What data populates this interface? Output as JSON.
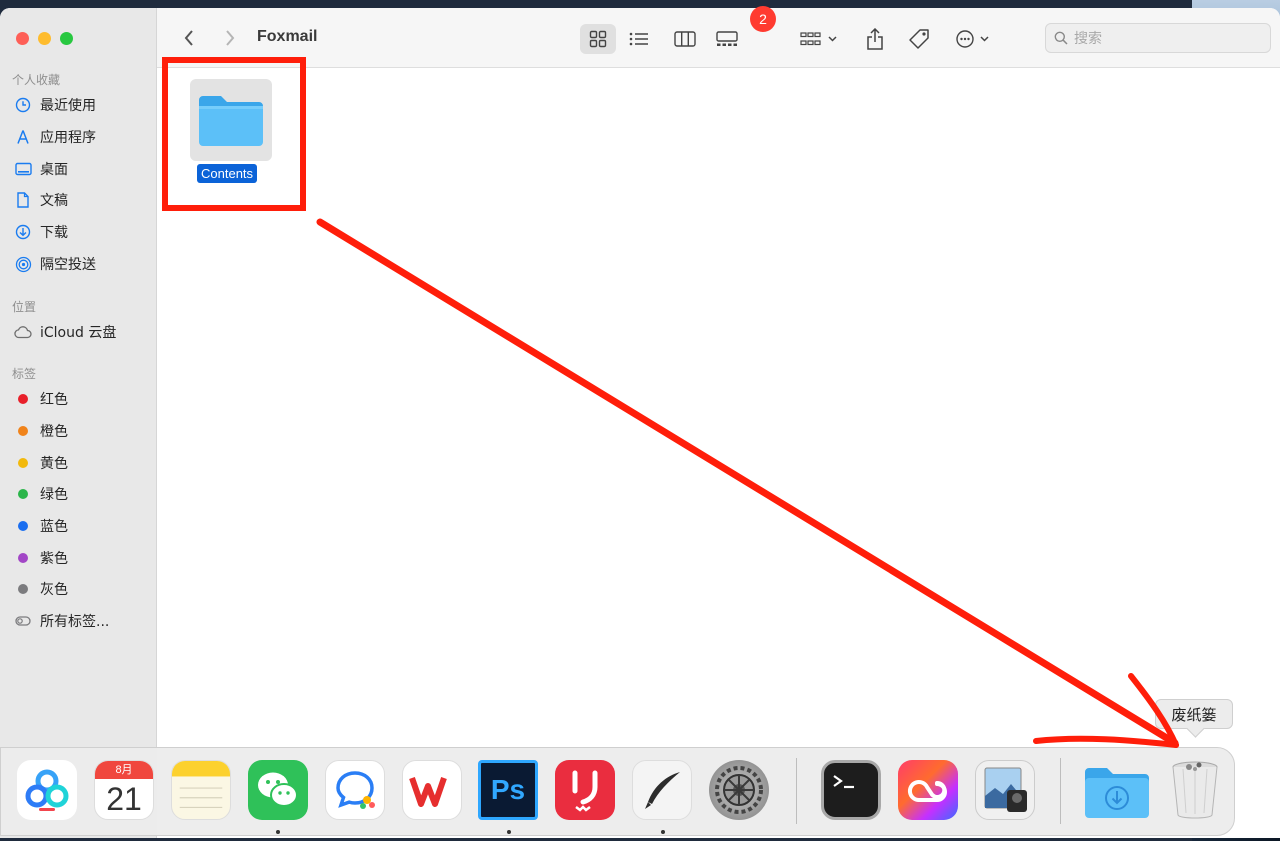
{
  "window": {
    "title": "Foxmail",
    "search_placeholder": "搜索"
  },
  "sidebar": {
    "favorites_header": "个人收藏",
    "favorites": [
      {
        "label": "最近使用",
        "icon": "clock-icon"
      },
      {
        "label": "应用程序",
        "icon": "apps-icon"
      },
      {
        "label": "桌面",
        "icon": "desktop-icon"
      },
      {
        "label": "文稿",
        "icon": "document-icon"
      },
      {
        "label": "下载",
        "icon": "download-icon"
      },
      {
        "label": "隔空投送",
        "icon": "airdrop-icon"
      }
    ],
    "locations_header": "位置",
    "locations": [
      {
        "label": "iCloud 云盘",
        "icon": "cloud-icon"
      }
    ],
    "tags_header": "标签",
    "tags": [
      {
        "label": "红色",
        "color": "#e8202a"
      },
      {
        "label": "橙色",
        "color": "#f0831a"
      },
      {
        "label": "黄色",
        "color": "#f2b90c"
      },
      {
        "label": "绿色",
        "color": "#2bb54a"
      },
      {
        "label": "蓝色",
        "color": "#1a6ef0"
      },
      {
        "label": "紫色",
        "color": "#a246c6"
      },
      {
        "label": "灰色",
        "color": "#7b7b7e"
      }
    ],
    "all_tags": "所有标签..."
  },
  "content": {
    "items": [
      {
        "name": "Contents",
        "icon": "folder-icon",
        "selected": true
      }
    ]
  },
  "dock": {
    "calendar_month": "8月",
    "calendar_day": "21",
    "photoshop_label": "Ps",
    "settings_badge": "2",
    "trash_tooltip": "废纸篓"
  },
  "colors": {
    "annotation": "#ff1e0a",
    "selection": "#0b63d8",
    "folder": "#5cc0f8"
  }
}
